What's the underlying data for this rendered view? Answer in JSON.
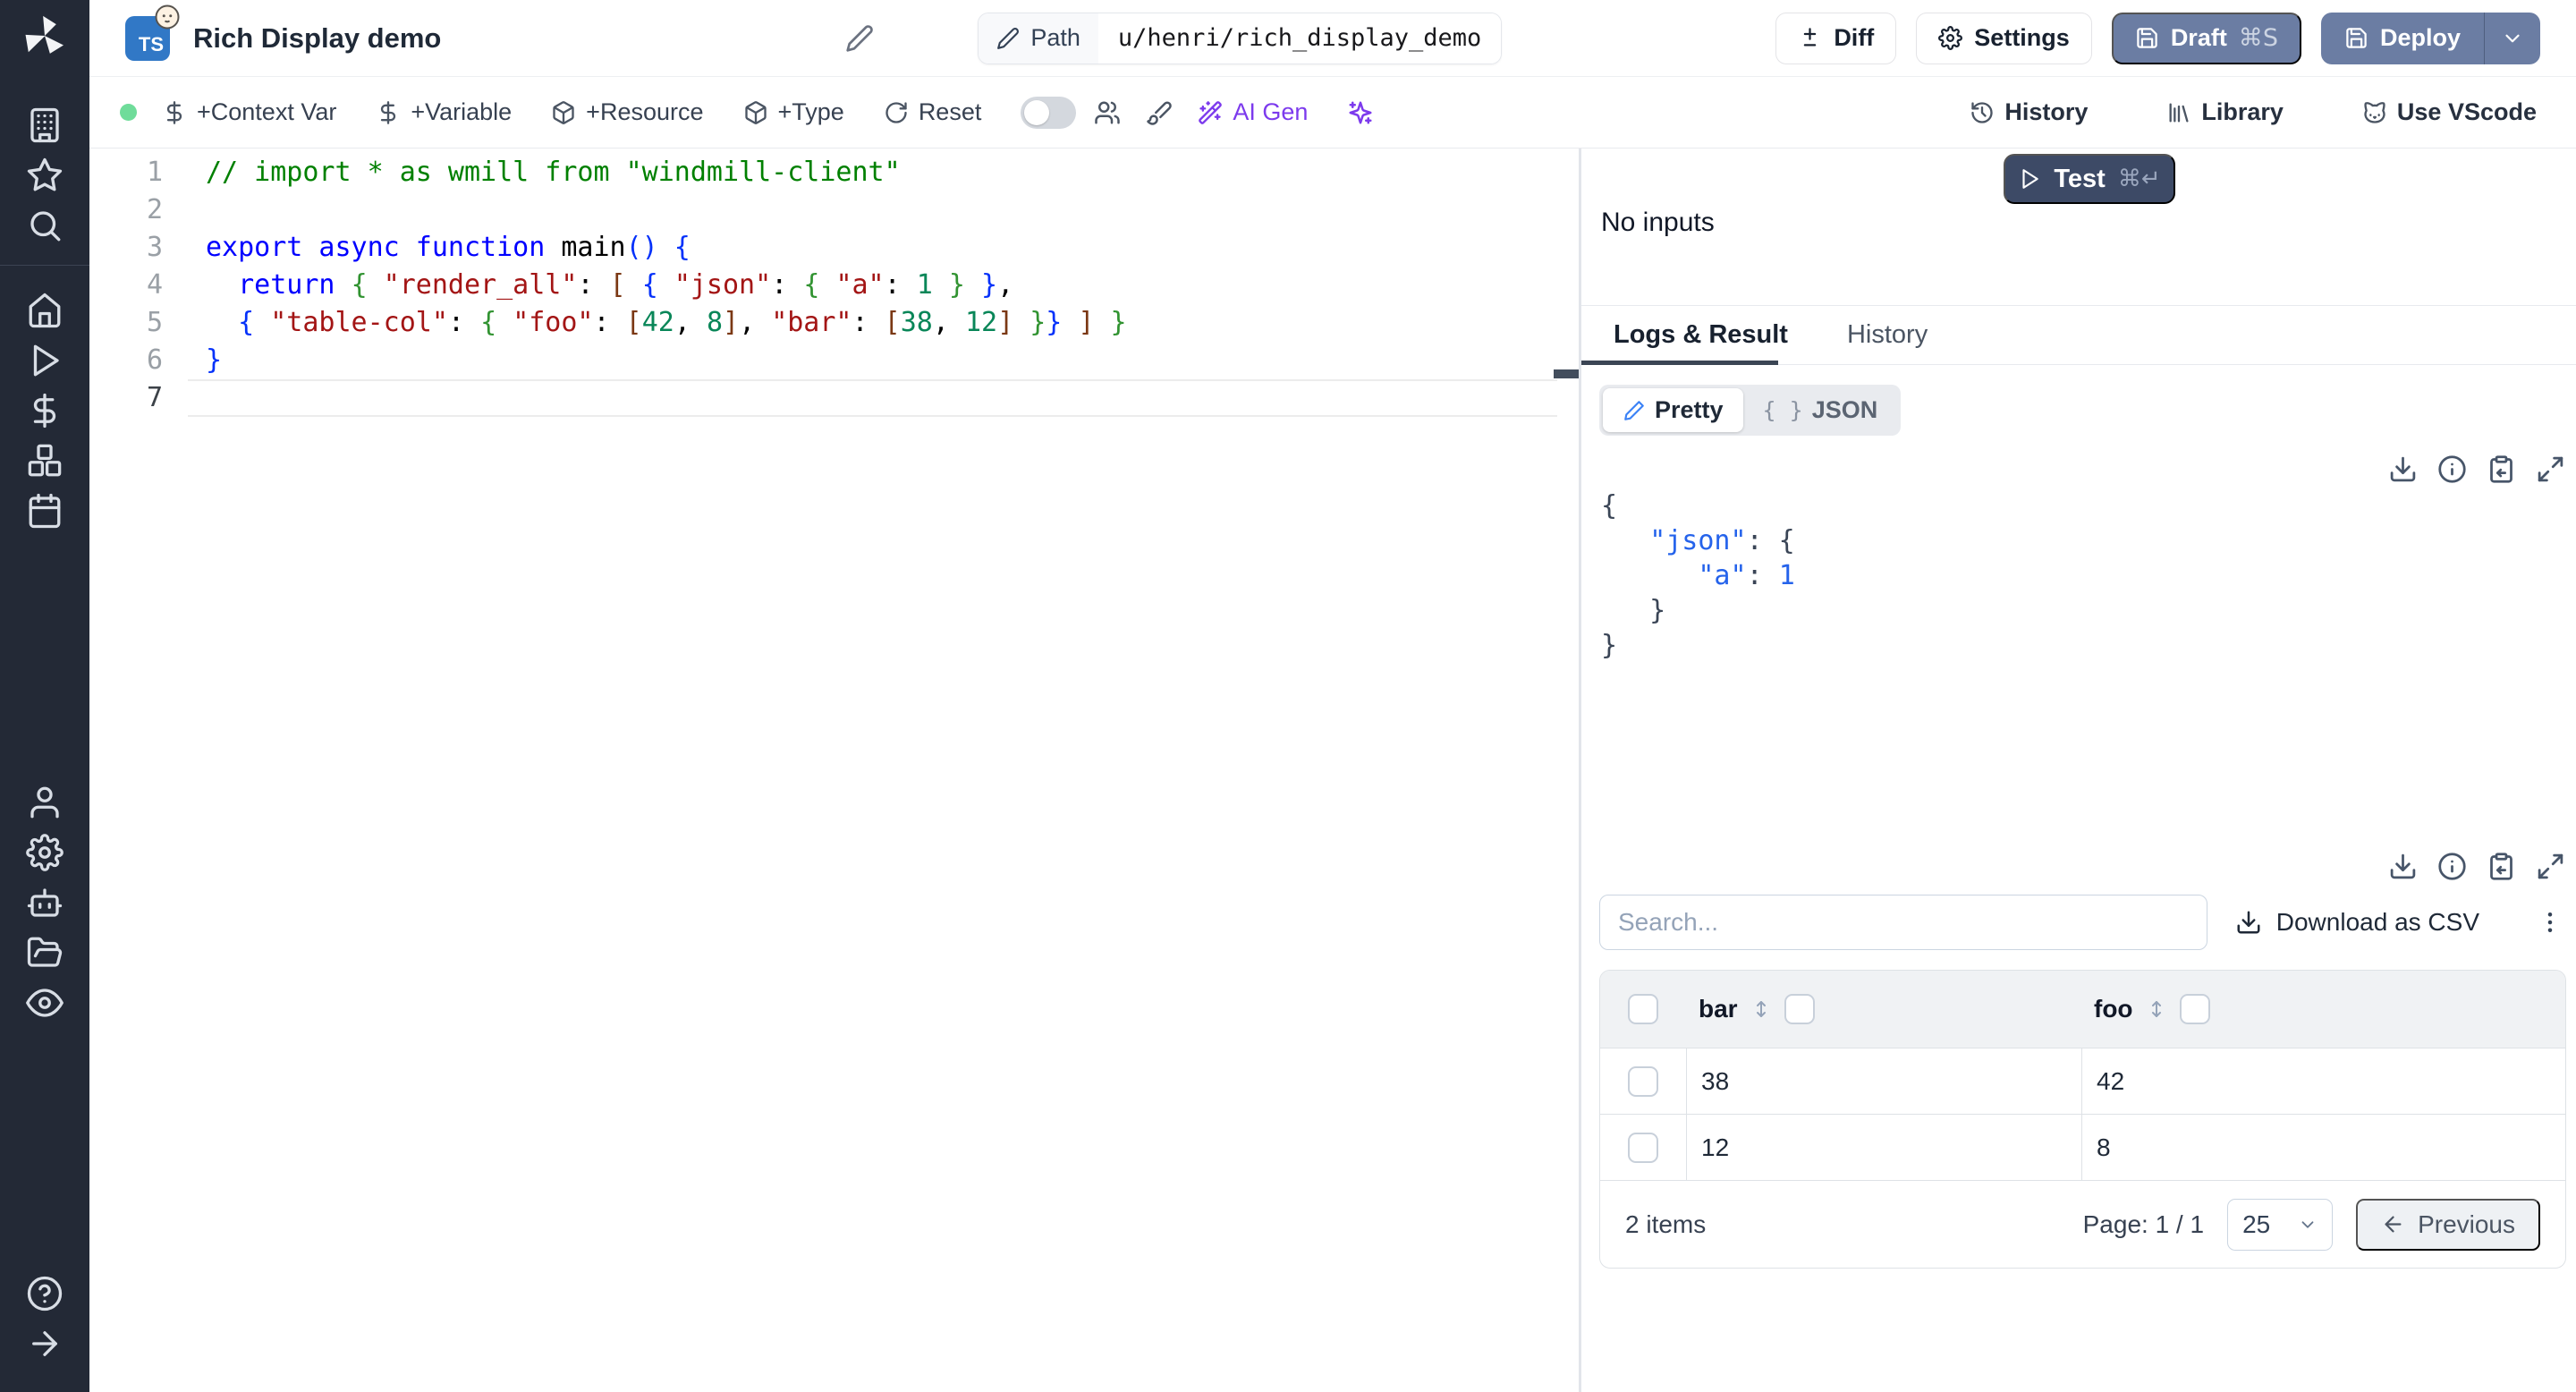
{
  "colors": {
    "accent_blue": "#3b82f6",
    "slate_button": "#6b7da3",
    "test_button": "#3d4a66",
    "ai_purple": "#7c3aed",
    "status_green": "#6fdc9a",
    "ts_badge_blue": "#3178c6"
  },
  "topbar": {
    "title": "Rich Display demo",
    "language_badge": "TS",
    "path_label": "Path",
    "path_value": "u/henri/rich_display_demo",
    "diff_label": "Diff",
    "settings_label": "Settings",
    "draft_label": "Draft",
    "draft_shortcut": "⌘S",
    "deploy_label": "Deploy"
  },
  "toolbar": {
    "context_var_label": "+Context Var",
    "variable_label": "+Variable",
    "resource_label": "+Resource",
    "type_label": "+Type",
    "reset_label": "Reset",
    "ai_gen_label": "AI Gen",
    "history_label": "History",
    "library_label": "Library",
    "vscode_label": "Use VScode"
  },
  "sidebar_icon_names": [
    "windmill-logo",
    "building-icon",
    "star-icon",
    "search-icon",
    "home-icon",
    "play-icon",
    "dollar-icon",
    "boxes-icon",
    "calendar-icon",
    "user-icon",
    "gear-icon",
    "bot-icon",
    "folder-icon",
    "eye-icon",
    "help-icon",
    "arrow-right-icon"
  ],
  "editor": {
    "lines": [
      {
        "no": "1",
        "tokens": [
          [
            "cm",
            "// import * as wmill from \"windmill-client\""
          ]
        ]
      },
      {
        "no": "2",
        "tokens": []
      },
      {
        "no": "3",
        "tokens": [
          [
            "kw",
            "export async function "
          ],
          [
            "pl",
            "main"
          ],
          [
            "b1",
            "()"
          ],
          [
            "pl",
            " "
          ],
          [
            "b1",
            "{"
          ]
        ]
      },
      {
        "no": "4",
        "tokens": [
          [
            "pl",
            "  "
          ],
          [
            "kw",
            "return"
          ],
          [
            "pl",
            " "
          ],
          [
            "b2",
            "{"
          ],
          [
            "pl",
            " "
          ],
          [
            "str",
            "\"render_all\""
          ],
          [
            "pl",
            ": "
          ],
          [
            "b3",
            "["
          ],
          [
            "pl",
            " "
          ],
          [
            "b1",
            "{"
          ],
          [
            "pl",
            " "
          ],
          [
            "str",
            "\"json\""
          ],
          [
            "pl",
            ": "
          ],
          [
            "b2",
            "{"
          ],
          [
            "pl",
            " "
          ],
          [
            "str",
            "\"a\""
          ],
          [
            "pl",
            ": "
          ],
          [
            "num",
            "1"
          ],
          [
            "pl",
            " "
          ],
          [
            "b2",
            "}"
          ],
          [
            "pl",
            " "
          ],
          [
            "b1",
            "}"
          ],
          [
            "pl",
            ","
          ]
        ]
      },
      {
        "no": "5",
        "tokens": [
          [
            "pl",
            "  "
          ],
          [
            "b1",
            "{"
          ],
          [
            "pl",
            " "
          ],
          [
            "str",
            "\"table-col\""
          ],
          [
            "pl",
            ": "
          ],
          [
            "b2",
            "{"
          ],
          [
            "pl",
            " "
          ],
          [
            "str",
            "\"foo\""
          ],
          [
            "pl",
            ": "
          ],
          [
            "b3",
            "["
          ],
          [
            "num",
            "42"
          ],
          [
            "pl",
            ", "
          ],
          [
            "num",
            "8"
          ],
          [
            "b3",
            "]"
          ],
          [
            "pl",
            ", "
          ],
          [
            "str",
            "\"bar\""
          ],
          [
            "pl",
            ": "
          ],
          [
            "b3",
            "["
          ],
          [
            "num",
            "38"
          ],
          [
            "pl",
            ", "
          ],
          [
            "num",
            "12"
          ],
          [
            "b3",
            "]"
          ],
          [
            "pl",
            " "
          ],
          [
            "b2",
            "}"
          ],
          [
            "b1",
            "}"
          ],
          [
            "pl",
            " "
          ],
          [
            "b3",
            "]"
          ],
          [
            "pl",
            " "
          ],
          [
            "b2",
            "}"
          ]
        ]
      },
      {
        "no": "6",
        "tokens": [
          [
            "b1",
            "}"
          ]
        ]
      },
      {
        "no": "7",
        "tokens": [],
        "active": true
      }
    ]
  },
  "run_panel": {
    "test_label": "Test",
    "test_shortcut": "⌘↵",
    "no_inputs_label": "No inputs"
  },
  "result_panel": {
    "tabs": {
      "logs_result": "Logs & Result",
      "history": "History"
    },
    "view_toggle": {
      "pretty": "Pretty",
      "braces": "{ }",
      "json": "JSON"
    },
    "json_lines": [
      [
        [
          "jp",
          "{"
        ]
      ],
      [
        [
          "jp",
          "   "
        ],
        [
          "jk",
          "\"json\""
        ],
        [
          "jp",
          ": {"
        ]
      ],
      [
        [
          "jp",
          "      "
        ],
        [
          "jk",
          "\"a\""
        ],
        [
          "jp",
          ": "
        ],
        [
          "jv",
          "1"
        ]
      ],
      [
        [
          "jp",
          "   }"
        ]
      ],
      [
        [
          "jp",
          "}"
        ]
      ]
    ],
    "icon_names": [
      "download-icon",
      "info-icon",
      "clipboard-copy-icon",
      "expand-icon"
    ]
  },
  "table": {
    "search_placeholder": "Search...",
    "download_csv_label": "Download as CSV",
    "columns": [
      "bar",
      "foo"
    ],
    "rows": [
      [
        "38",
        "42"
      ],
      [
        "12",
        "8"
      ]
    ],
    "items_count": "2 items",
    "page_label": "Page: 1 / 1",
    "page_size": "25",
    "previous_label": "Previous"
  }
}
